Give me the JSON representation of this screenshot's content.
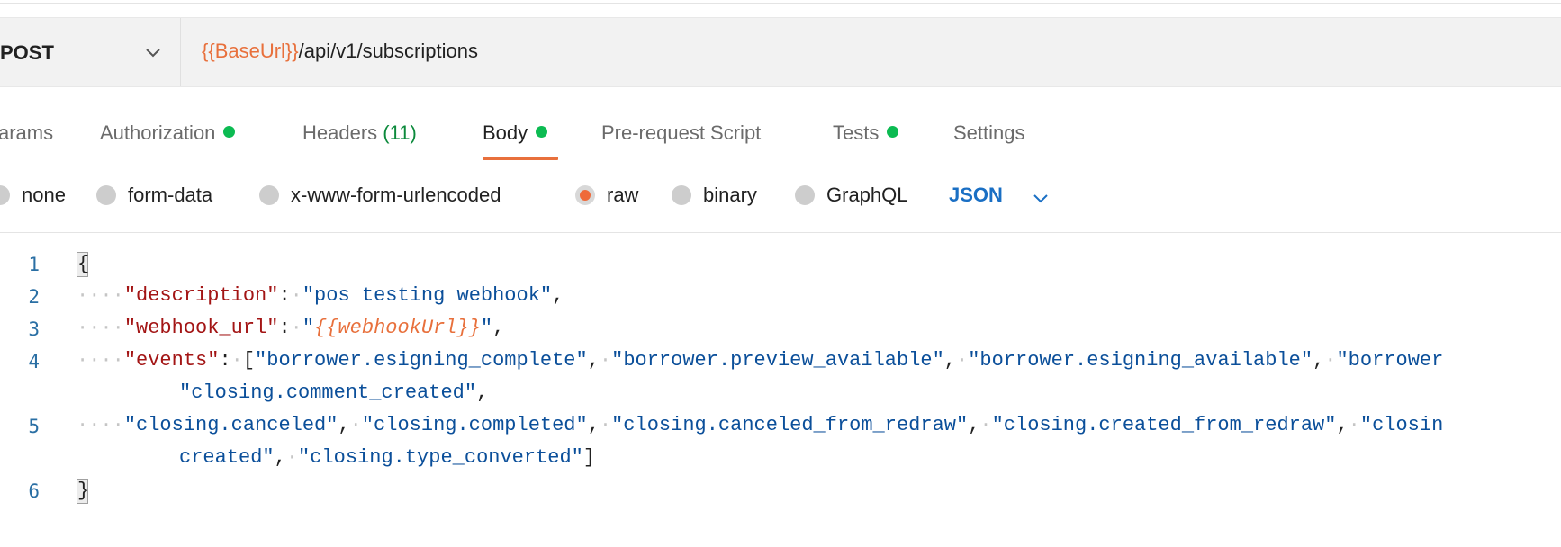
{
  "request": {
    "method": "POST",
    "url_variable": "{{BaseUrl}}",
    "url_path": "/api/v1/subscriptions"
  },
  "tabs": [
    {
      "label": "arams",
      "dot": false,
      "active": false
    },
    {
      "label": "Authorization",
      "dot": true,
      "active": false
    },
    {
      "label": "Headers",
      "count": "(11)",
      "dot": false,
      "active": false
    },
    {
      "label": "Body",
      "dot": true,
      "active": true
    },
    {
      "label": "Pre-request Script",
      "dot": false,
      "active": false
    },
    {
      "label": "Tests",
      "dot": true,
      "active": false
    },
    {
      "label": "Settings",
      "dot": false,
      "active": false
    }
  ],
  "body_types": {
    "options": [
      "none",
      "form-data",
      "x-www-form-urlencoded",
      "raw",
      "binary",
      "GraphQL"
    ],
    "selected": "raw",
    "format": "JSON"
  },
  "editor": {
    "line_numbers": [
      "1",
      "2",
      "3",
      "4",
      "5",
      "6"
    ],
    "open_brace": "{",
    "close_brace": "}",
    "description_key": "\"description\"",
    "description_value": "\"pos testing webhook\"",
    "webhook_url_key": "\"webhook_url\"",
    "webhook_url_value": "{{webhookUrl}}",
    "events_key": "\"events\"",
    "events_line1": [
      "\"borrower.esigning_complete\"",
      "\"borrower.preview_available\"",
      "\"borrower.esigning_available\"",
      "\"borrower"
    ],
    "events_line1_wrap": "\"closing.comment_created\"",
    "events_line2": [
      "\"closing.canceled\"",
      "\"closing.completed\"",
      "\"closing.canceled_from_redraw\"",
      "\"closing.created_from_redraw\"",
      "\"closin"
    ],
    "events_line2_wrap_a": "created\"",
    "events_line2_wrap_b": "\"closing.type_converted\""
  },
  "colors": {
    "accent_orange": "#e8703c",
    "status_green": "#0cbb52",
    "link_blue": "#1a6fc4",
    "json_key": "#a31515",
    "json_string": "#0b4f9a"
  }
}
